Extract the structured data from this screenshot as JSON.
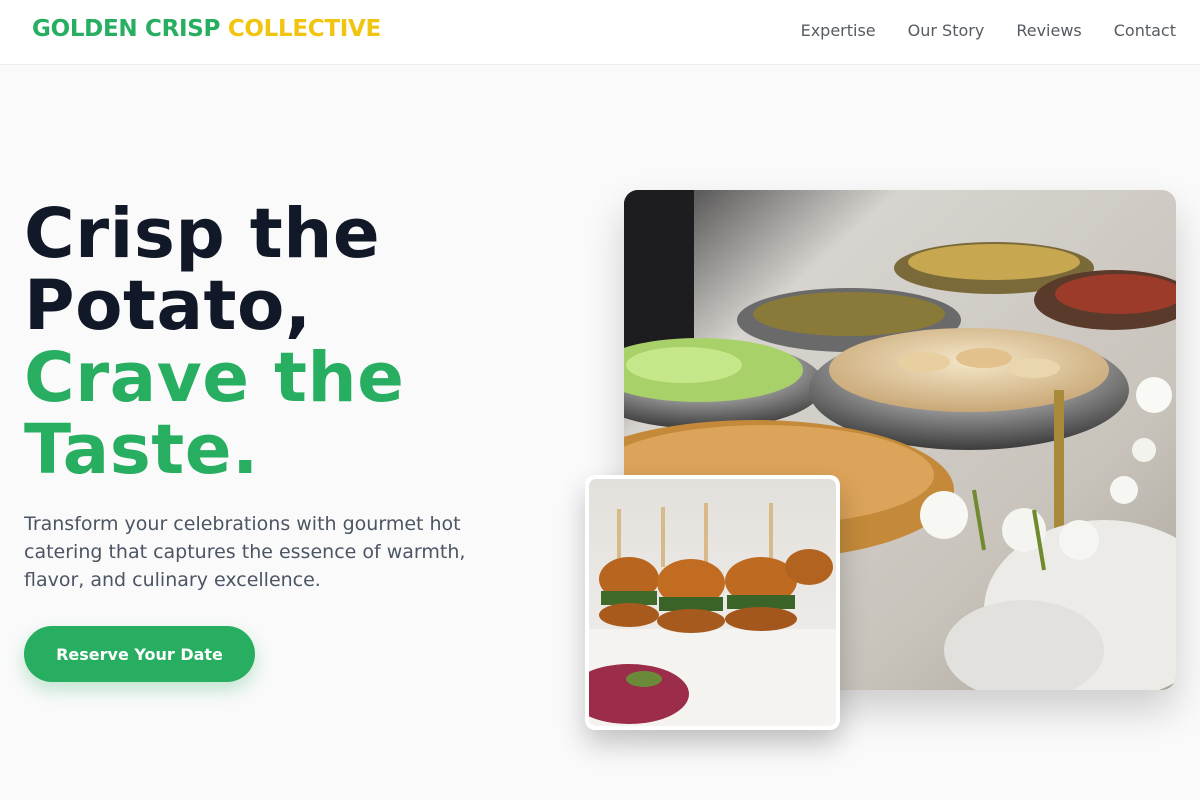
{
  "brand": {
    "part1": "GOLDEN CRISP",
    "part2": "COLLECTIVE"
  },
  "nav": [
    "Expertise",
    "Our Story",
    "Reviews",
    "Contact"
  ],
  "hero": {
    "line1": "Crisp the",
    "line2": "Potato,",
    "line3": "Crave the",
    "line4": "Taste.",
    "subtitle": "Transform your celebrations with gourmet hot catering that captures the essence of warmth, flavor, and culinary excellence.",
    "cta": "Reserve Your Date"
  },
  "colors": {
    "accent": "#27ae60",
    "brand_yellow": "#f1c40f",
    "heading": "#111827"
  },
  "images": {
    "main": "catering-buffet-chafing-dishes-photo",
    "thumb": "mini-burger-sliders-photo"
  }
}
